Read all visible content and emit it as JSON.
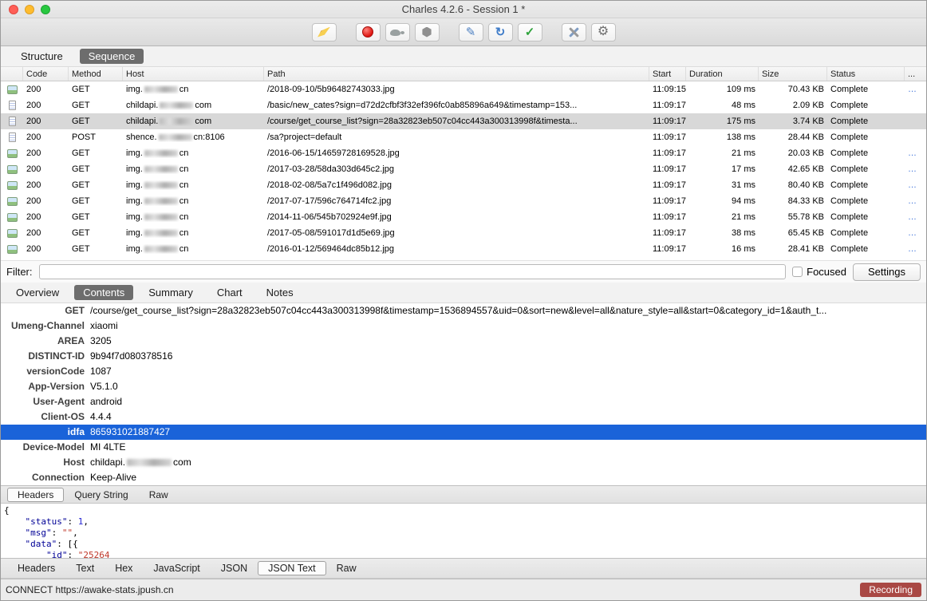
{
  "window": {
    "title": "Charles 4.2.6 - Session 1 *"
  },
  "toolbar": {
    "buttons": [
      {
        "name": "clear",
        "dn": "clear-session-button",
        "icon": "broom-icon",
        "glyph": ""
      },
      {
        "name": "record",
        "dn": "record-button",
        "icon": "record-icon",
        "glyph": ""
      },
      {
        "name": "throttle",
        "dn": "throttle-button",
        "icon": "tortoise-icon",
        "glyph": ""
      },
      {
        "name": "breakpoints",
        "dn": "breakpoints-button",
        "icon": "hexagon-icon",
        "glyph": ""
      },
      {
        "name": "compose",
        "dn": "compose-button",
        "icon": "pencil-icon",
        "glyph": "✎"
      },
      {
        "name": "repeat",
        "dn": "repeat-button",
        "icon": "repeat-icon",
        "glyph": "↻"
      },
      {
        "name": "validate",
        "dn": "validate-button",
        "icon": "check-icon",
        "glyph": "✓"
      },
      {
        "name": "tools",
        "dn": "tools-button",
        "icon": "tools-icon",
        "glyph": ""
      },
      {
        "name": "settings",
        "dn": "settings-button",
        "icon": "gear-icon",
        "glyph": "⚙"
      }
    ]
  },
  "nav_tabs": {
    "items": [
      {
        "label": "Structure",
        "dn": "tab-structure"
      },
      {
        "label": "Sequence",
        "dn": "tab-sequence",
        "selected": true
      }
    ]
  },
  "table": {
    "columns": [
      "",
      "Code",
      "Method",
      "Host",
      "Path",
      "Start",
      "Duration",
      "Size",
      "Status",
      "..."
    ],
    "rows": [
      {
        "icon": "image-icon",
        "code": "200",
        "method": "GET",
        "host1": "img.",
        "host2": "cn",
        "path": "/2018-09-10/5b96482743033.jpg",
        "start": "11:09:15",
        "duration": "109 ms",
        "size": "70.43 KB",
        "status": "Complete",
        "more": "…"
      },
      {
        "icon": "document-icon",
        "code": "200",
        "method": "GET",
        "host1": "childapi.",
        "host2": "com",
        "path": "/basic/new_cates?sign=d72d2cfbf3f32ef396fc0ab85896a649&timestamp=153...",
        "start": "11:09:17",
        "duration": "48 ms",
        "size": "2.09 KB",
        "status": "Complete",
        "more": ""
      },
      {
        "icon": "document-icon",
        "code": "200",
        "method": "GET",
        "host1": "childapi.",
        "host2": "com",
        "path": "/course/get_course_list?sign=28a32823eb507c04cc443a300313998f&timesta...",
        "start": "11:09:17",
        "duration": "175 ms",
        "size": "3.74 KB",
        "status": "Complete",
        "more": "",
        "selected": true
      },
      {
        "icon": "document-icon",
        "code": "200",
        "method": "POST",
        "host1": "shence.",
        "host2": "cn:8106",
        "path": "/sa?project=default",
        "start": "11:09:17",
        "duration": "138 ms",
        "size": "28.44 KB",
        "status": "Complete",
        "more": ""
      },
      {
        "icon": "image-icon",
        "code": "200",
        "method": "GET",
        "host1": "img.",
        "host2": "cn",
        "path": "/2016-06-15/14659728169528.jpg",
        "start": "11:09:17",
        "duration": "21 ms",
        "size": "20.03 KB",
        "status": "Complete",
        "more": "…"
      },
      {
        "icon": "image-icon",
        "code": "200",
        "method": "GET",
        "host1": "img.",
        "host2": "cn",
        "path": "/2017-03-28/58da303d645c2.jpg",
        "start": "11:09:17",
        "duration": "17 ms",
        "size": "42.65 KB",
        "status": "Complete",
        "more": "…"
      },
      {
        "icon": "image-icon",
        "code": "200",
        "method": "GET",
        "host1": "img.",
        "host2": "cn",
        "path": "/2018-02-08/5a7c1f496d082.jpg",
        "start": "11:09:17",
        "duration": "31 ms",
        "size": "80.40 KB",
        "status": "Complete",
        "more": "…"
      },
      {
        "icon": "image-icon",
        "code": "200",
        "method": "GET",
        "host1": "img.",
        "host2": "cn",
        "path": "/2017-07-17/596c764714fc2.jpg",
        "start": "11:09:17",
        "duration": "94 ms",
        "size": "84.33 KB",
        "status": "Complete",
        "more": "…"
      },
      {
        "icon": "image-icon",
        "code": "200",
        "method": "GET",
        "host1": "img.",
        "host2": "cn",
        "path": "/2014-11-06/545b702924e9f.jpg",
        "start": "11:09:17",
        "duration": "21 ms",
        "size": "55.78 KB",
        "status": "Complete",
        "more": "…"
      },
      {
        "icon": "image-icon",
        "code": "200",
        "method": "GET",
        "host1": "img.",
        "host2": "cn",
        "path": "/2017-05-08/591017d1d5e69.jpg",
        "start": "11:09:17",
        "duration": "38 ms",
        "size": "65.45 KB",
        "status": "Complete",
        "more": "…"
      },
      {
        "icon": "image-icon",
        "code": "200",
        "method": "GET",
        "host1": "img.",
        "host2": "cn",
        "path": "/2016-01-12/569464dc85b12.jpg",
        "start": "11:09:17",
        "duration": "16 ms",
        "size": "28.41 KB",
        "status": "Complete",
        "more": "…"
      }
    ]
  },
  "filter": {
    "label": "Filter:",
    "value": "",
    "focused_label": "Focused",
    "settings_label": "Settings"
  },
  "detail_tabs": {
    "items": [
      {
        "label": "Overview",
        "dn": "tab-overview"
      },
      {
        "label": "Contents",
        "dn": "tab-contents",
        "selected": true
      },
      {
        "label": "Summary",
        "dn": "tab-summary"
      },
      {
        "label": "Chart",
        "dn": "tab-chart"
      },
      {
        "label": "Notes",
        "dn": "tab-notes"
      }
    ]
  },
  "request": {
    "headers": [
      {
        "name": "GET",
        "value": "/course/get_course_list?sign=28a32823eb507c04cc443a300313998f&timestamp=1536894557&uid=0&sort=new&level=all&nature_style=all&start=0&category_id=1&auth_t...",
        "value2": ""
      },
      {
        "name": "Umeng-Channel",
        "value": "xiaomi",
        "value2": ""
      },
      {
        "name": "AREA",
        "value": "3205",
        "value2": ""
      },
      {
        "name": "DISTINCT-ID",
        "value": "9b94f7d080378516",
        "value2": ""
      },
      {
        "name": "versionCode",
        "value": "1087",
        "value2": ""
      },
      {
        "name": "App-Version",
        "value": "V5.1.0",
        "value2": ""
      },
      {
        "name": "User-Agent",
        "value": "android",
        "value2": ""
      },
      {
        "name": "Client-OS",
        "value": "4.4.4",
        "value2": ""
      },
      {
        "name": "idfa",
        "value": "865931021887427",
        "value2": "",
        "selected": true
      },
      {
        "name": "Device-Model",
        "value": "MI 4LTE",
        "value2": ""
      },
      {
        "name": "Host",
        "value": "childapi.",
        "value2": "com",
        "redact": true
      },
      {
        "name": "Connection",
        "value": "Keep-Alive",
        "value2": ""
      }
    ],
    "tabs": [
      {
        "label": "Headers",
        "dn": "request-tab-headers",
        "selected": true
      },
      {
        "label": "Query String",
        "dn": "request-tab-query-string"
      },
      {
        "label": "Raw",
        "dn": "request-tab-raw"
      }
    ]
  },
  "response": {
    "lines": [
      [
        {
          "c": "p",
          "t": "{"
        }
      ],
      [
        {
          "c": "p",
          "t": "    "
        },
        {
          "c": "k",
          "t": "\"status\""
        },
        {
          "c": "p",
          "t": ": "
        },
        {
          "c": "n",
          "t": "1"
        },
        {
          "c": "p",
          "t": ","
        }
      ],
      [
        {
          "c": "p",
          "t": "    "
        },
        {
          "c": "k",
          "t": "\"msg\""
        },
        {
          "c": "p",
          "t": ": "
        },
        {
          "c": "s",
          "t": "\"\""
        },
        {
          "c": "p",
          "t": ","
        }
      ],
      [
        {
          "c": "p",
          "t": "    "
        },
        {
          "c": "k",
          "t": "\"data\""
        },
        {
          "c": "p",
          "t": ": "
        },
        {
          "c": "p",
          "t": "[{"
        }
      ],
      [
        {
          "c": "p",
          "t": "        "
        },
        {
          "c": "k",
          "t": "\"id\""
        },
        {
          "c": "p",
          "t": ": "
        },
        {
          "c": "s",
          "t": "\"25264"
        }
      ]
    ],
    "tabs": [
      {
        "label": "Headers",
        "dn": "response-tab-headers"
      },
      {
        "label": "Text",
        "dn": "response-tab-text"
      },
      {
        "label": "Hex",
        "dn": "response-tab-hex"
      },
      {
        "label": "JavaScript",
        "dn": "response-tab-javascript"
      },
      {
        "label": "JSON",
        "dn": "response-tab-json"
      },
      {
        "label": "JSON Text",
        "dn": "response-tab-json-text",
        "selected": true
      },
      {
        "label": "Raw",
        "dn": "response-tab-raw"
      }
    ]
  },
  "status_bar": {
    "left": "CONNECT https://awake-stats.jpush.cn",
    "badge": "Recording"
  }
}
